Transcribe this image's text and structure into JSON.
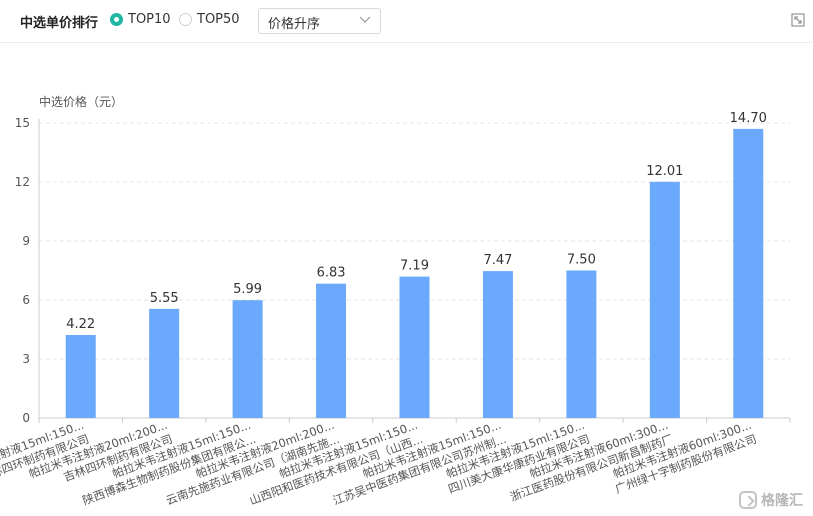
{
  "toolbar": {
    "title": "中选单价排行",
    "options": [
      {
        "label": "TOP10",
        "checked": true
      },
      {
        "label": "TOP50",
        "checked": false
      }
    ],
    "sort_select": {
      "value": "价格升序"
    }
  },
  "watermark": {
    "text": "格隆汇"
  },
  "colors": {
    "bar": "#6aa9fb",
    "accent": "#1fb6a5",
    "grid": "#e6e6e6"
  },
  "icons": {
    "expand": "expand-icon",
    "chevron": "chevron-down-icon",
    "logo": "glh-logo-icon"
  },
  "chart_data": {
    "type": "bar",
    "ylabel": "中选价格（元）",
    "ylim": [
      0,
      15
    ],
    "yticks": [
      0,
      3,
      6,
      9,
      12,
      15
    ],
    "grid": true,
    "categories": [
      {
        "line1": "帕拉米韦注射液15ml:150...",
        "line2": "吉林四环制药有限公司"
      },
      {
        "line1": "帕拉米韦注射液20ml:200...",
        "line2": "吉林四环制药有限公司"
      },
      {
        "line1": "帕拉米韦注射液15ml:150...",
        "line2": "陕西博森生物制药股份集团有限公..."
      },
      {
        "line1": "帕拉米韦注射液20ml:200...",
        "line2": "云南先施药业有限公司（湖南先施..."
      },
      {
        "line1": "帕拉米韦注射液15ml:150...",
        "line2": "山西阳和医药技术有限公司（山西..."
      },
      {
        "line1": "帕拉米韦注射液15ml:150...",
        "line2": "江苏吴中医药集团有限公司苏州制..."
      },
      {
        "line1": "帕拉米韦注射液15ml:150...",
        "line2": "四川美大康华康药业有限公司"
      },
      {
        "line1": "帕拉米韦注射液60ml:300...",
        "line2": "浙江医药股份有限公司新昌制药厂"
      },
      {
        "line1": "帕拉米韦注射液60ml:300...",
        "line2": "广州绿十字制药股份有限公司"
      }
    ],
    "values": [
      4.22,
      5.55,
      5.99,
      6.83,
      7.19,
      7.47,
      7.5,
      12.01,
      14.7
    ],
    "value_labels": [
      "4.22",
      "5.55",
      "5.99",
      "6.83",
      "7.19",
      "7.47",
      "7.50",
      "12.01",
      "14.70"
    ]
  }
}
